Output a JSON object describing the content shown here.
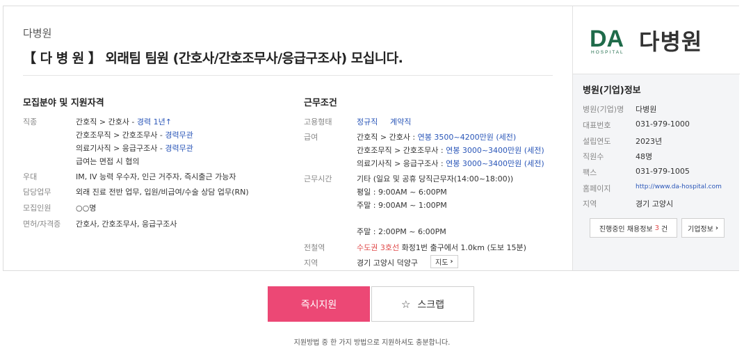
{
  "header": {
    "company_name": "다병원",
    "title": "【 다 병 원 】 외래팀 팀원 (간호사/간호조무사/응급구조사) 모십니다."
  },
  "qualifications": {
    "heading": "모집분야 및 지원자격",
    "rows": {
      "job_type": {
        "label": "직종",
        "line1_prefix": "간호직 > 간호사 - ",
        "line1_accent": "경력 1년↑",
        "line2_prefix": "간호조무직 > 간호조무사 - ",
        "line2_accent": "경력무관",
        "line3_prefix": "의료기사직 > 응급구조사 - ",
        "line3_accent": "경력무관",
        "line4": "급여는 면접 시 협의"
      },
      "preference": {
        "label": "우대",
        "value": "IM, IV 능력 우수자, 인근 거주자, 즉시출근 가능자"
      },
      "duties": {
        "label": "담당업무",
        "value": "외래 진료 전반 업무, 입원/비급여/수술 상담 업무(RN)"
      },
      "headcount": {
        "label": "모집인원",
        "value": "○○명"
      },
      "license": {
        "label": "면허/자격증",
        "value": "간호사, 간호조무사, 응급구조사"
      }
    }
  },
  "conditions": {
    "heading": "근무조건",
    "employment": {
      "label": "고용형태",
      "value1": "정규직",
      "value2": "계약직"
    },
    "salary": {
      "label": "급여",
      "line1_prefix": "간호직 > 간호사 : ",
      "line1_accent": "연봉 3500~4200만원 (세전)",
      "line2_prefix": "간호조무직 > 간호조무사 : ",
      "line2_accent": "연봉 3000~3400만원 (세전)",
      "line3_prefix": "의료기사직 > 응급구조사 : ",
      "line3_accent": "연봉 3000~3400만원 (세전)"
    },
    "hours": {
      "label": "근무시간",
      "line1": "기타 (일요 및 공휴 당직근무자(14:00~18:00))",
      "line2": "평일 : 9:00AM ~ 6:00PM",
      "line3": "주말 : 9:00AM ~ 1:00PM",
      "line4": "주말 : 2:00PM ~ 6:00PM"
    },
    "subway": {
      "label": "전철역",
      "line": "수도권 3호선",
      "rest": " 화정1번 출구에서 1.0km (도보 15분)"
    },
    "region": {
      "label": "지역",
      "value": "경기 고양시 덕양구",
      "map_label": "지도"
    }
  },
  "sidebar": {
    "logo_mark": "DA",
    "logo_sub": "HOSPITAL",
    "logo_text": "다병원",
    "heading": "병원(기업)정보",
    "rows": {
      "name": {
        "label": "병원(기업)명",
        "value": "다병원"
      },
      "phone": {
        "label": "대표번호",
        "value": "031-979-1000"
      },
      "founded": {
        "label": "설립연도",
        "value": "2023년"
      },
      "staff": {
        "label": "직원수",
        "value": "48명"
      },
      "fax": {
        "label": "팩스",
        "value": "031-979-1005"
      },
      "homepage": {
        "label": "홈페이지",
        "value": "http://www.da-hospital.com"
      },
      "region": {
        "label": "지역",
        "value": "경기 고양시"
      }
    },
    "jobs_button_prefix": "진행중인 채용정보 ",
    "jobs_button_count": "3",
    "jobs_button_suffix": "건",
    "company_button": "기업정보"
  },
  "actions": {
    "apply": "즉시지원",
    "scrap": "스크랩",
    "notice": "지원방법 중 한 가지 방법으로 지원하셔도 충분합니다."
  },
  "colors": {
    "accent_blue": "#2a56b8",
    "apply_pink": "#ec4875",
    "logo_green": "#1f6b4a"
  }
}
